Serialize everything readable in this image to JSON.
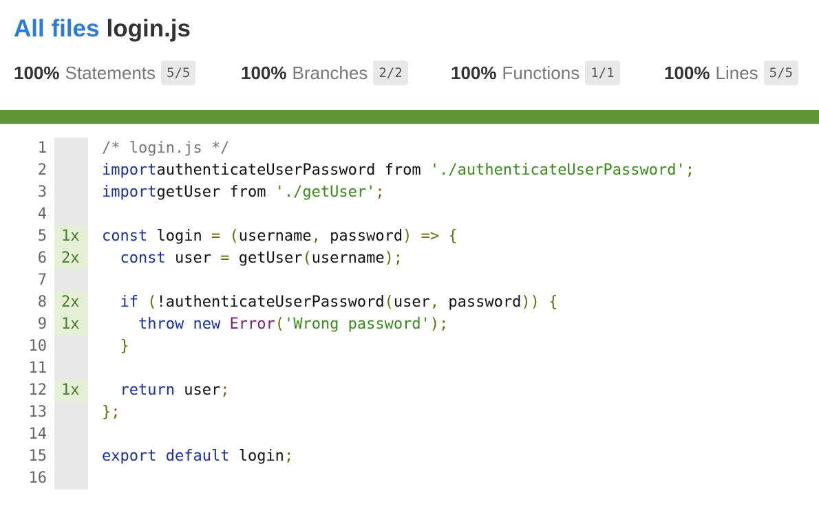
{
  "breadcrumb": {
    "root_label": "All files",
    "file_label": "login.js"
  },
  "summary": [
    {
      "pct": "100%",
      "label": "Statements",
      "fraction": "5/5"
    },
    {
      "pct": "100%",
      "label": "Branches",
      "fraction": "2/2"
    },
    {
      "pct": "100%",
      "label": "Functions",
      "fraction": "1/1"
    },
    {
      "pct": "100%",
      "label": "Lines",
      "fraction": "5/5"
    }
  ],
  "coverage_status_color": "#5f9535",
  "lines": [
    {
      "num": "1",
      "count": "",
      "tokens": [
        [
          "cm",
          "/* login.js */"
        ]
      ]
    },
    {
      "num": "2",
      "count": "",
      "tokens": [
        [
          "kw",
          "import"
        ],
        [
          "",
          "authenticateUserPassword "
        ],
        [
          "",
          "from "
        ],
        [
          "str",
          "'./authenticateUserPassword'"
        ],
        [
          "punc",
          ";"
        ]
      ]
    },
    {
      "num": "3",
      "count": "",
      "tokens": [
        [
          "kw",
          "import"
        ],
        [
          "",
          "getUser "
        ],
        [
          "",
          "from "
        ],
        [
          "str",
          "'./getUser'"
        ],
        [
          "punc",
          ";"
        ]
      ]
    },
    {
      "num": "4",
      "count": "",
      "tokens": []
    },
    {
      "num": "5",
      "count": "1x",
      "tokens": [
        [
          "kw",
          "const"
        ],
        [
          "",
          " login "
        ],
        [
          "punc",
          "="
        ],
        [
          "",
          " "
        ],
        [
          "punc",
          "("
        ],
        [
          "",
          "username"
        ],
        [
          "punc",
          ","
        ],
        [
          "",
          " password"
        ],
        [
          "punc",
          ")"
        ],
        [
          "",
          " "
        ],
        [
          "punc",
          "=>"
        ],
        [
          "",
          " "
        ],
        [
          "punc",
          "{"
        ]
      ]
    },
    {
      "num": "6",
      "count": "2x",
      "tokens": [
        [
          "",
          "  "
        ],
        [
          "kw",
          "const"
        ],
        [
          "",
          " user "
        ],
        [
          "punc",
          "="
        ],
        [
          "",
          " getUser"
        ],
        [
          "punc",
          "("
        ],
        [
          "",
          "username"
        ],
        [
          "punc",
          ")"
        ],
        [
          "punc",
          ";"
        ]
      ]
    },
    {
      "num": "7",
      "count": "",
      "tokens": []
    },
    {
      "num": "8",
      "count": "2x",
      "tokens": [
        [
          "",
          "  "
        ],
        [
          "kw",
          "if"
        ],
        [
          "",
          " "
        ],
        [
          "punc",
          "("
        ],
        [
          "",
          "!authenticateUserPassword"
        ],
        [
          "punc",
          "("
        ],
        [
          "",
          "user"
        ],
        [
          "punc",
          ","
        ],
        [
          "",
          " password"
        ],
        [
          "punc",
          "))"
        ],
        [
          "",
          " "
        ],
        [
          "punc",
          "{"
        ]
      ]
    },
    {
      "num": "9",
      "count": "1x",
      "tokens": [
        [
          "",
          "    "
        ],
        [
          "kw",
          "throw"
        ],
        [
          "",
          " "
        ],
        [
          "kw",
          "new"
        ],
        [
          "",
          " "
        ],
        [
          "cls",
          "Error"
        ],
        [
          "punc",
          "("
        ],
        [
          "str",
          "'Wrong password'"
        ],
        [
          "punc",
          ")"
        ],
        [
          "punc",
          ";"
        ]
      ]
    },
    {
      "num": "10",
      "count": "",
      "tokens": [
        [
          "",
          "  "
        ],
        [
          "punc",
          "}"
        ]
      ]
    },
    {
      "num": "11",
      "count": "",
      "tokens": []
    },
    {
      "num": "12",
      "count": "1x",
      "tokens": [
        [
          "",
          "  "
        ],
        [
          "kw",
          "return"
        ],
        [
          "",
          " user"
        ],
        [
          "punc",
          ";"
        ]
      ]
    },
    {
      "num": "13",
      "count": "",
      "tokens": [
        [
          "punc",
          "};"
        ]
      ]
    },
    {
      "num": "14",
      "count": "",
      "tokens": []
    },
    {
      "num": "15",
      "count": "",
      "tokens": [
        [
          "kw",
          "export"
        ],
        [
          "",
          " "
        ],
        [
          "kw",
          "default"
        ],
        [
          "",
          " login"
        ],
        [
          "punc",
          ";"
        ]
      ]
    },
    {
      "num": "16",
      "count": "",
      "tokens": []
    }
  ]
}
